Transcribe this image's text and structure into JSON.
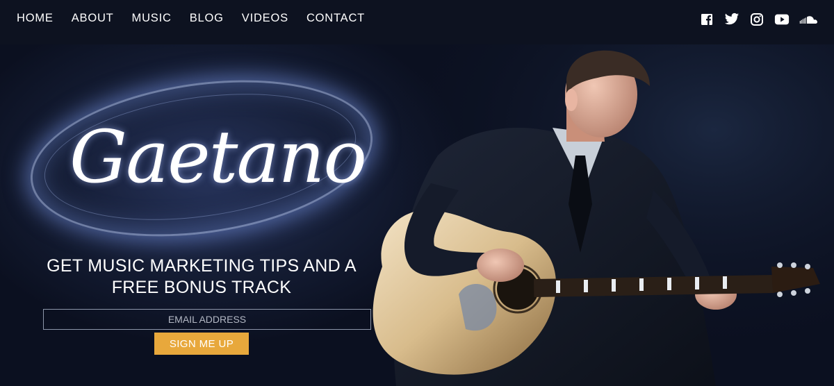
{
  "nav": {
    "items": [
      {
        "label": "HOME"
      },
      {
        "label": "ABOUT"
      },
      {
        "label": "MUSIC"
      },
      {
        "label": "BLOG"
      },
      {
        "label": "VIDEOS"
      },
      {
        "label": "CONTACT"
      }
    ]
  },
  "social": {
    "icons": [
      "facebook-icon",
      "twitter-icon",
      "instagram-icon",
      "youtube-icon",
      "soundcloud-icon"
    ]
  },
  "hero": {
    "logo_text": "Gaetano",
    "headline_line1": "GET MUSIC MARKETING TIPS AND A",
    "headline_line2": "FREE BONUS TRACK",
    "email_placeholder": "EMAIL ADDRESS",
    "signup_label": "SIGN ME UP"
  },
  "colors": {
    "topbar": "#0d1220",
    "accent_button": "#e8a83c",
    "background": "#0b1020"
  }
}
